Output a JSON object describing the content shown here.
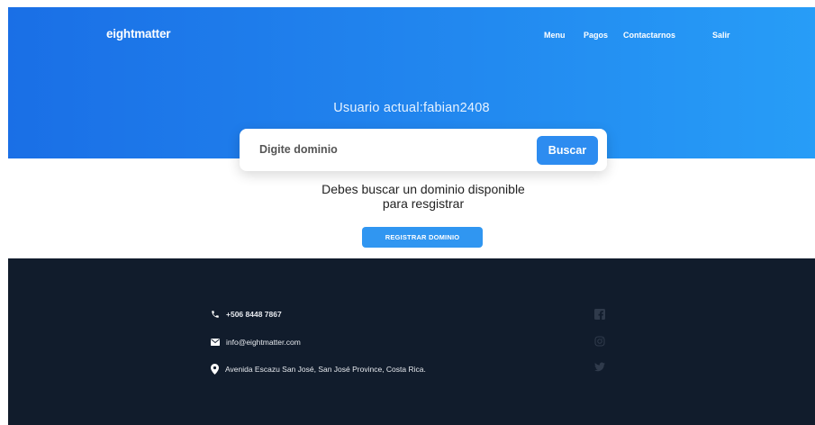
{
  "header": {
    "logo": "eightmatter",
    "nav": {
      "menu": "Menu",
      "pagos": "Pagos",
      "contactarnos": "Contactarnos",
      "salir": "Salir"
    },
    "user_label": "Usuario actual:fabian2408"
  },
  "search": {
    "placeholder": "Digite dominio",
    "button_label": "Buscar"
  },
  "message": {
    "line1": "Debes buscar un dominio disponible",
    "line2": "para resgistrar"
  },
  "register_button_label": "REGISTRAR DOMINIO",
  "footer": {
    "phone": "+506 8448 7867",
    "email": "info@eightmatter.com",
    "address": "Avenida Escazu San José, San José Province, Costa Rica.",
    "social_icons": [
      "facebook-icon",
      "instagram-icon",
      "twitter-icon"
    ]
  },
  "colors": {
    "hero_gradient_start": "#1a6fe6",
    "hero_gradient_end": "#279df7",
    "button_blue": "#2d8cf0",
    "footer_bg": "#111c2c"
  }
}
